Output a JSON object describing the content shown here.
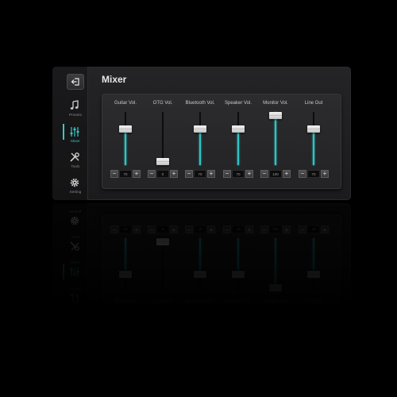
{
  "app": {
    "title": "Mixer"
  },
  "sidebar": {
    "items": [
      {
        "label": "Presets",
        "icon": "music-note-icon"
      },
      {
        "label": "Mixer",
        "icon": "sliders-icon",
        "active": true
      },
      {
        "label": "Tools",
        "icon": "tools-icon"
      },
      {
        "label": "Setting",
        "icon": "gear-icon"
      }
    ]
  },
  "channels": [
    {
      "label": "Guitar Vol.",
      "value": "70",
      "level": 0.7
    },
    {
      "label": "OTG Vol.",
      "value": "0",
      "level": 0.0
    },
    {
      "label": "Bluetooth Vol.",
      "value": "70",
      "level": 0.7
    },
    {
      "label": "Speaker Vol.",
      "value": "70",
      "level": 0.7
    },
    {
      "label": "Monitor Vol.",
      "value": "100",
      "level": 1.0
    },
    {
      "label": "Line Out",
      "value": "70",
      "level": 0.7
    }
  ],
  "stepper": {
    "minus": "−",
    "plus": "+"
  },
  "colors": {
    "accent": "#2fc4c4",
    "background": "#000000",
    "panel": "#2a2a2c"
  }
}
